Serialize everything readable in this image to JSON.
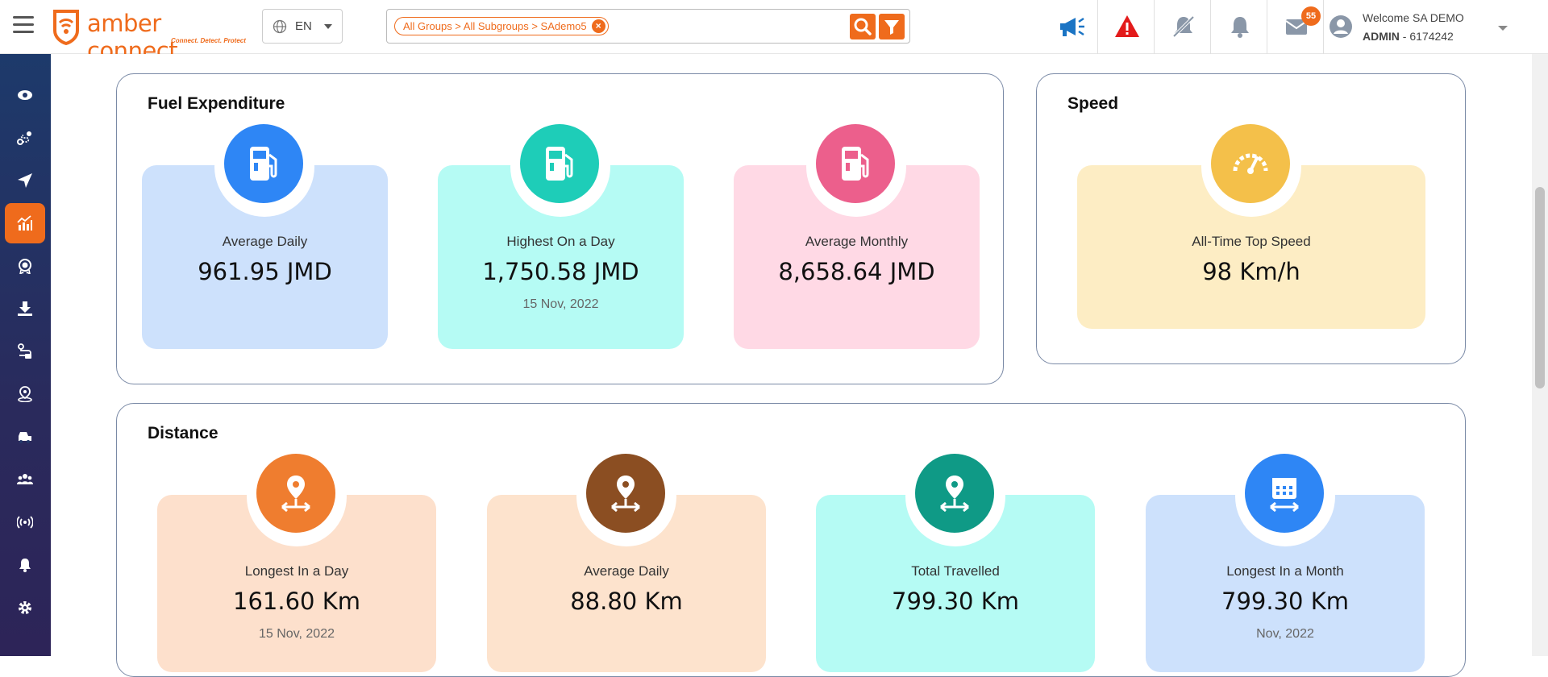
{
  "header": {
    "logo_text": "amber connect",
    "logo_tagline": "Connect. Detect. Protect",
    "language": "EN",
    "breadcrumb_chip": "All Groups > All Subgroups > SAdemo5",
    "notifications_count": "55",
    "welcome": "Welcome SA DEMO",
    "user_role": "ADMIN",
    "user_id": "- 6174242"
  },
  "sidebar": {
    "items": [
      "eye",
      "route",
      "navigate",
      "analytics",
      "award",
      "download",
      "trip-route",
      "location-person",
      "vehicles",
      "users",
      "broadcast",
      "alerts",
      "settings"
    ],
    "active": "analytics"
  },
  "fuel": {
    "title": "Fuel Expenditure",
    "tiles": [
      {
        "label": "Average Daily",
        "value": "961.95 JMD",
        "sub": ""
      },
      {
        "label": "Highest On a Day",
        "value": "1,750.58 JMD",
        "sub": "15 Nov, 2022"
      },
      {
        "label": "Average Monthly",
        "value": "8,658.64 JMD",
        "sub": ""
      }
    ]
  },
  "speed": {
    "title": "Speed",
    "tile": {
      "label": "All-Time Top Speed",
      "value": "98 Km/h"
    }
  },
  "distance": {
    "title": "Distance",
    "tiles": [
      {
        "label": "Longest In a Day",
        "value": "161.60 Km",
        "sub": "15 Nov, 2022"
      },
      {
        "label": "Average Daily",
        "value": "88.80 Km",
        "sub": ""
      },
      {
        "label": "Total Travelled",
        "value": "799.30 Km",
        "sub": ""
      },
      {
        "label": "Longest In a Month",
        "value": "799.30 Km",
        "sub": "Nov, 2022"
      }
    ]
  },
  "colors": {
    "brand": "#ef6b1c",
    "blue": "#2e86f5",
    "teal": "#1ecdb8",
    "pink": "#ec5f8c",
    "yellow": "#f4c04a",
    "orange": "#ef7d2f",
    "brown": "#8b4e22",
    "green": "#0f9a86"
  }
}
